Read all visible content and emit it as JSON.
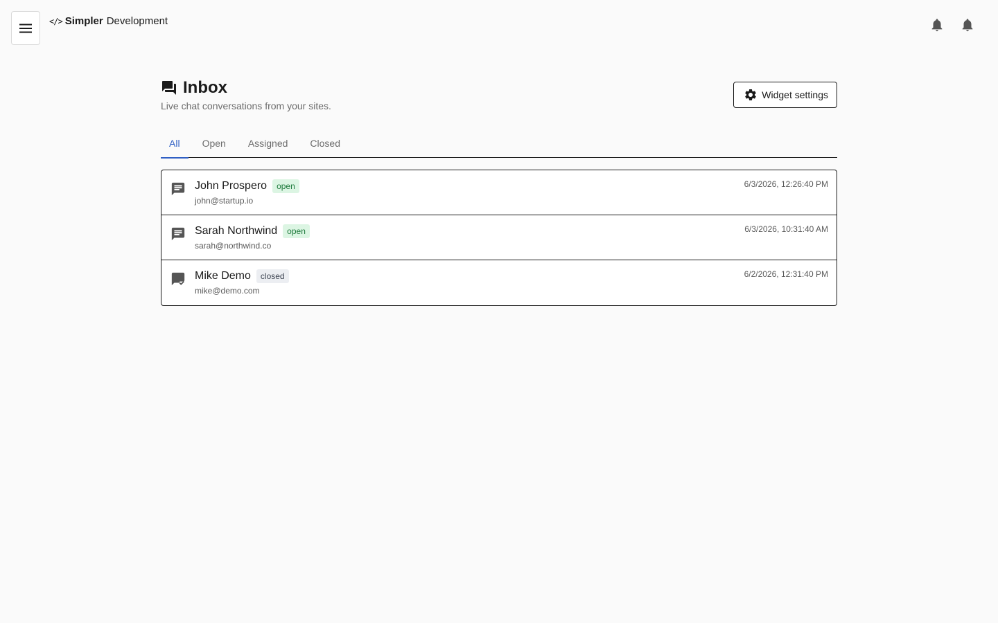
{
  "topbar": {
    "menu_icon": "hamburger-icon",
    "brand_glyph": "</>",
    "brand_bold": "Simpler",
    "brand_rest": "Development",
    "bell_icons": [
      "bell-icon",
      "bell-icon"
    ]
  },
  "page": {
    "title": "Inbox",
    "title_icon": "forum-icon",
    "subtitle": "Live chat conversations from your sites.",
    "widget_button_label": "Widget settings",
    "widget_button_icon": "gear-icon"
  },
  "tabs": [
    {
      "label": "All",
      "active": true
    },
    {
      "label": "Open",
      "active": false
    },
    {
      "label": "Assigned",
      "active": false
    },
    {
      "label": "Closed",
      "active": false
    }
  ],
  "conversations": [
    {
      "name": "John Prospero",
      "email": "john@startup.io",
      "status": "open",
      "time": "6/3/2026, 12:26:40 PM",
      "icon": "chat-icon"
    },
    {
      "name": "Sarah Northwind",
      "email": "sarah@northwind.co",
      "status": "open",
      "time": "6/3/2026, 10:31:40 AM",
      "icon": "chat-icon"
    },
    {
      "name": "Mike Demo",
      "email": "mike@demo.com",
      "status": "closed",
      "time": "6/2/2026, 12:31:40 PM",
      "icon": "chat-checked-icon"
    }
  ],
  "colors": {
    "accent": "#2f5fc4",
    "open_badge_bg": "#dcf5e3",
    "open_badge_text": "#1e7a3c",
    "closed_badge_bg": "#eceef2",
    "closed_badge_text": "#3e4552"
  }
}
